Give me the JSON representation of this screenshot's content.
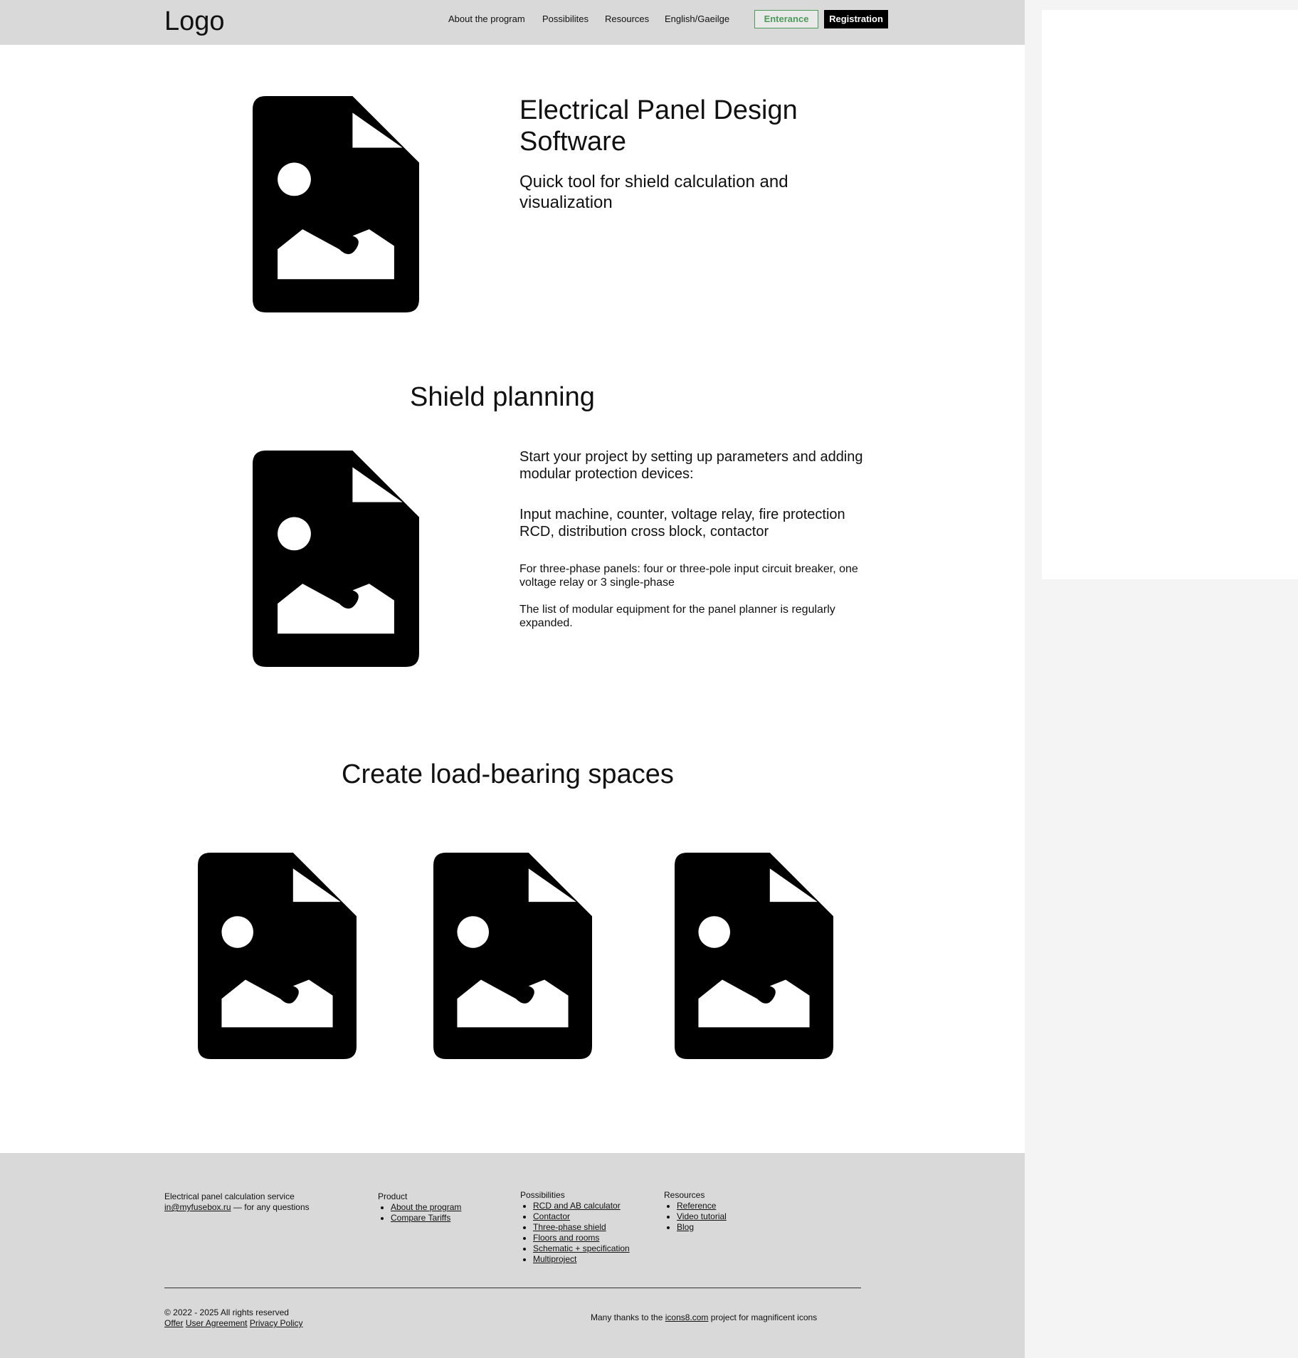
{
  "header": {
    "logo": "Logo",
    "nav": [
      "About the program",
      "Possibilites",
      "Resources",
      "English/Gaeilge"
    ],
    "enter_label": "Enterance",
    "register_label": "Registration"
  },
  "colors": {
    "header_bg": "#d9d9d9",
    "accent_green": "#4a9a5a",
    "footer_bg": "#d9d9d9"
  },
  "hero": {
    "title": "Electrical Panel Design Software",
    "subtitle": "Quick tool for shield calculation and visualization",
    "image_icon": "image-file-icon"
  },
  "planning": {
    "heading": "Shield planning",
    "p1": "Start your project by setting up parameters and adding modular protection devices:",
    "p2": "Input machine, counter, voltage relay, fire protection RCD, distribution cross block, contactor",
    "p3": "For three-phase panels: four or three-pole input circuit breaker, one voltage relay or 3 single-phase",
    "p4": "The list of modular equipment for the panel planner is regularly expanded."
  },
  "spaces": {
    "heading": "Create load-bearing spaces"
  },
  "footer": {
    "service": "Electrical panel calculation service",
    "email": "in@myfusebox.ru",
    "email_suffix": " — for any questions",
    "product": {
      "title": "Product",
      "items": [
        "About the program",
        "Compare Tariffs"
      ]
    },
    "possibilities": {
      "title": "Possibilities",
      "items": [
        "RCD and AB calculator",
        "Contactor",
        "Three-phase shield",
        "Floors and rooms",
        "Schematic + specification",
        "Multiproject"
      ]
    },
    "resources": {
      "title": "Resources",
      "items": [
        "Reference",
        "Video tutorial",
        "Blog"
      ]
    },
    "copyright": "© 2022 - 2025 All rights reserved",
    "legal": [
      "Offer",
      "User Agreement",
      "Privacy Policy"
    ],
    "thanks_prefix": "Many thanks to the ",
    "thanks_link": "icons8.com",
    "thanks_suffix": " project for magnificent icons"
  }
}
